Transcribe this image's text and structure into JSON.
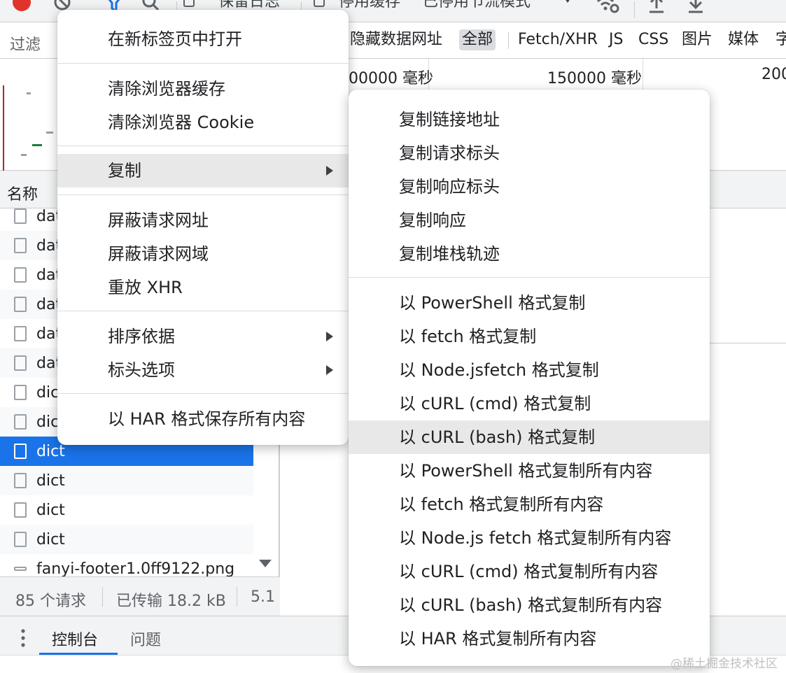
{
  "toolbar": {
    "preserve_log_label": "保留日志",
    "disable_cache_label": "停用缓存",
    "throttling_label": "已停用节流模式"
  },
  "filter_bar": {
    "filter_label": "过滤",
    "types": [
      {
        "label": "隐藏数据网址",
        "active": false
      },
      {
        "label": "全部",
        "active": true
      },
      {
        "label": "Fetch/XHR",
        "active": false
      },
      {
        "label": "JS",
        "active": false
      },
      {
        "label": "CSS",
        "active": false
      },
      {
        "label": "图片",
        "active": false
      },
      {
        "label": "媒体",
        "active": false
      },
      {
        "label": "字",
        "active": false
      }
    ]
  },
  "timeline": {
    "ticks": [
      "00000 毫秒",
      "150000 毫秒",
      "200"
    ]
  },
  "request_list": {
    "header_name": "名称",
    "rows": [
      {
        "name": "dat",
        "icon": "document-icon",
        "selected": false
      },
      {
        "name": "dat",
        "icon": "exchange-icon",
        "selected": false
      },
      {
        "name": "dat",
        "icon": "download-icon",
        "selected": false
      },
      {
        "name": "dat",
        "icon": "blocked-icon",
        "selected": false
      },
      {
        "name": "dat",
        "icon": "image-icon",
        "selected": false
      },
      {
        "name": "dat",
        "icon": "media-icon",
        "selected": false
      },
      {
        "name": "dict",
        "icon": "file-icon",
        "selected": false
      },
      {
        "name": "dict",
        "icon": "file-icon",
        "selected": false
      },
      {
        "name": "dict",
        "icon": "file-icon",
        "selected": true
      },
      {
        "name": "dict",
        "icon": "file-icon",
        "selected": false
      },
      {
        "name": "dict",
        "icon": "file-icon",
        "selected": false
      },
      {
        "name": "dict",
        "icon": "file-icon",
        "selected": false
      },
      {
        "name": "fanyi-footer1.0ff9122.png",
        "icon": "image-icon",
        "selected": false
      }
    ]
  },
  "status_bar": {
    "requests": "85 个请求",
    "transferred": "已传输 18.2 kB",
    "resources": "5.1"
  },
  "drawer": {
    "tabs": [
      {
        "label": "控制台",
        "active": true
      },
      {
        "label": "问题",
        "active": false
      }
    ]
  },
  "context_menu": {
    "items": [
      {
        "label": "在新标签页中打开"
      },
      {
        "label": "清除浏览器缓存"
      },
      {
        "label": "清除浏览器 Cookie"
      },
      {
        "label": "复制",
        "submenu": true,
        "highlighted": true
      },
      {
        "label": "屏蔽请求网址"
      },
      {
        "label": "屏蔽请求网域"
      },
      {
        "label": "重放 XHR"
      },
      {
        "label": "排序依据",
        "submenu": true
      },
      {
        "label": "标头选项",
        "submenu": true
      },
      {
        "label": "以 HAR 格式保存所有内容"
      }
    ]
  },
  "copy_submenu": {
    "items": [
      {
        "label": "复制链接地址"
      },
      {
        "label": "复制请求标头"
      },
      {
        "label": "复制响应标头"
      },
      {
        "label": "复制响应"
      },
      {
        "label": "复制堆栈轨迹"
      },
      {
        "label": "以 PowerShell 格式复制"
      },
      {
        "label": "以 fetch 格式复制"
      },
      {
        "label": "以 Node.jsfetch 格式复制"
      },
      {
        "label": "以 cURL (cmd) 格式复制"
      },
      {
        "label": "以 cURL (bash) 格式复制",
        "highlighted": true
      },
      {
        "label": "以 PowerShell 格式复制所有内容"
      },
      {
        "label": "以 fetch 格式复制所有内容"
      },
      {
        "label": "以 Node.js fetch 格式复制所有内容"
      },
      {
        "label": "以 cURL (cmd) 格式复制所有内容"
      },
      {
        "label": "以 cURL (bash) 格式复制所有内容"
      },
      {
        "label": "以 HAR 格式复制所有内容"
      }
    ]
  },
  "watermark": "@稀土掘金技术社区"
}
